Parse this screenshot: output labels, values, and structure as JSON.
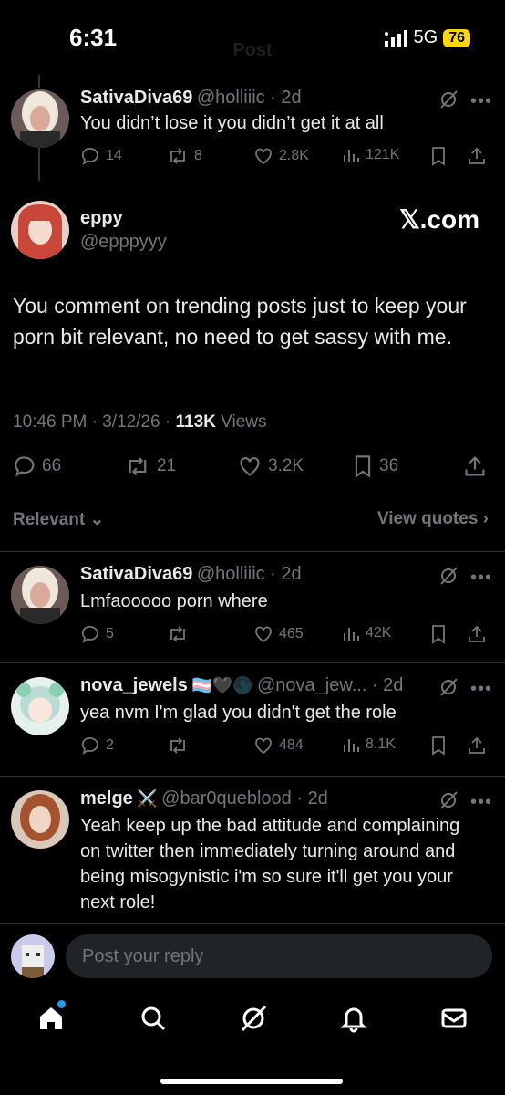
{
  "status": {
    "time": "6:31",
    "network": "5G",
    "battery": "76"
  },
  "header": {
    "title": "Post"
  },
  "parent_reply": {
    "name": "SativaDiva69",
    "handle": "@holliiic",
    "age": "2d",
    "text": "You didn’t lose it you didn’t get it at all",
    "replies": "14",
    "reposts": "8",
    "likes": "2.8K",
    "views": "121K"
  },
  "main_post": {
    "name": "eppy",
    "handle": "@epppyyy",
    "source": "𝕏.com",
    "text": "You comment on trending posts just to keep your porn bit relevant, no need to get sassy with me.",
    "time": "10:46 PM",
    "date": "3/12/26",
    "views_count": "113K",
    "views_label": "Views",
    "replies": "66",
    "reposts": "21",
    "likes": "3.2K",
    "bookmarks": "36"
  },
  "sort": {
    "relevant": "Relevant",
    "view_quotes": "View quotes"
  },
  "replies": [
    {
      "name": "SativaDiva69",
      "badge": "",
      "handle": "@holliiic",
      "age": "2d",
      "text": "Lmfaooooo porn where",
      "replies": "5",
      "reposts": "",
      "likes": "465",
      "views": "42K"
    },
    {
      "name": "nova_jewels",
      "badge": "🏳️‍⚧️🖤🌑",
      "handle": "@nova_jew...",
      "age": "2d",
      "text": "yea nvm I'm glad you didn't get the role",
      "replies": "2",
      "reposts": "",
      "likes": "484",
      "views": "8.1K"
    },
    {
      "name": "melge",
      "badge": "⚔️",
      "handle": "@bar0queblood",
      "age": "2d",
      "text": "Yeah keep up the bad attitude and complaining on twitter then immediately turning around and being misogynistic i'm so sure it'll get you your next role!"
    }
  ],
  "reply_input": {
    "placeholder": "Post your reply"
  },
  "colors": {
    "background": "#000000",
    "text": "#e7e9ea",
    "secondary": "#71767b",
    "divider": "#2f3336",
    "battery": "#ffd60a",
    "notification_dot": "#1d9bf0"
  }
}
